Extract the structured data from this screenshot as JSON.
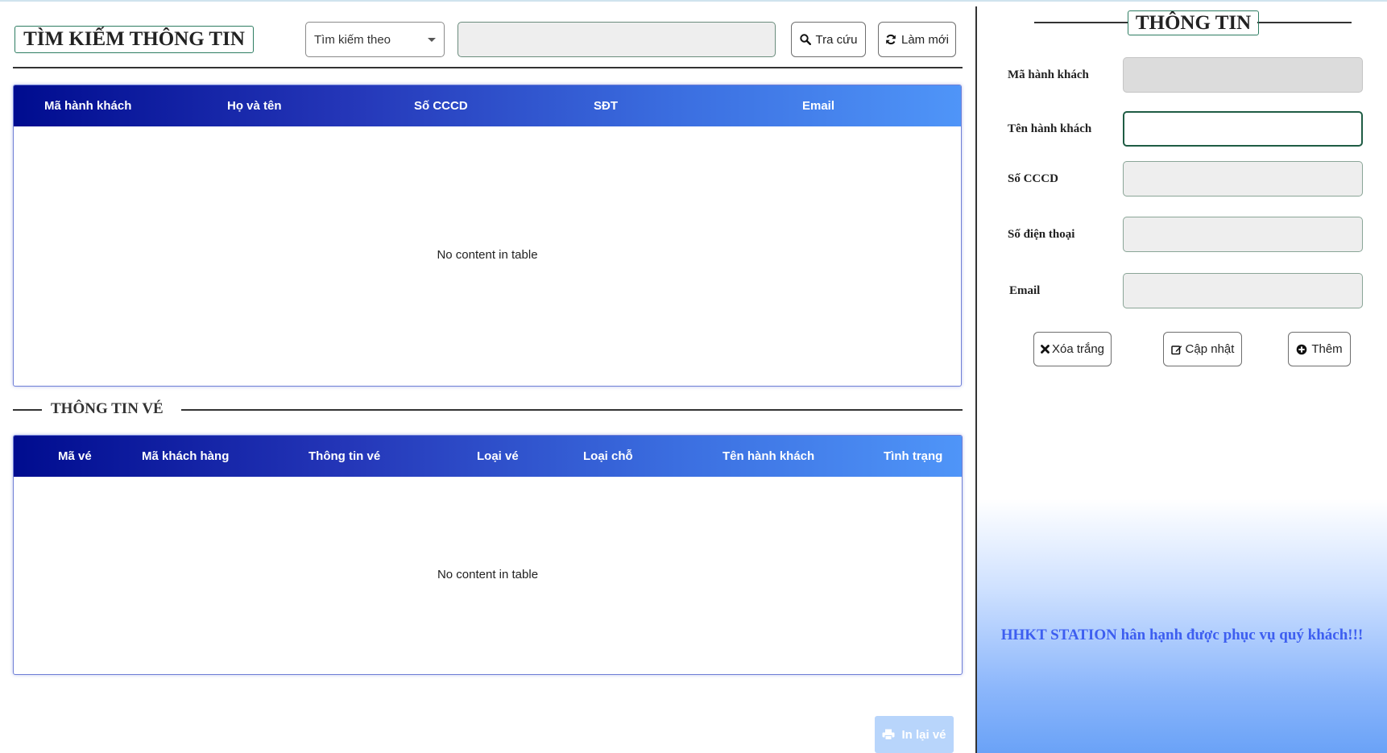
{
  "search": {
    "title": "TÌM KIẾM THÔNG TIN",
    "combo_label": "Tìm kiếm theo",
    "input_value": "",
    "lookup_label": "Tra cứu",
    "refresh_label": "Làm mới"
  },
  "passenger_table": {
    "columns": [
      "Mã hành khách",
      "Họ và tên",
      "Số CCCD",
      "SĐT",
      "Email"
    ],
    "empty_text": "No content in table"
  },
  "ticket_section": {
    "title": "THÔNG TIN VÉ"
  },
  "ticket_table": {
    "columns": [
      "Mã vé",
      "Mã khách hàng",
      "Thông tin vé",
      "Loại vé",
      "Loại chỗ",
      "Tên hành khách",
      "Tình trạng"
    ],
    "empty_text": "No content in table"
  },
  "print_button": {
    "label": "In lại vé"
  },
  "info_panel": {
    "title": "THÔNG TIN",
    "fields": [
      {
        "label": "Mã hành khách",
        "value": ""
      },
      {
        "label": "Tên hành khách",
        "value": ""
      },
      {
        "label": "Số CCCD",
        "value": ""
      },
      {
        "label": "Số điện thoại",
        "value": ""
      },
      {
        "label": "Email",
        "value": ""
      }
    ],
    "clear_label": "Xóa trắng",
    "update_label": "Cập nhật",
    "add_label": "Thêm",
    "slogan": "HHKT STATION hân hạnh được phục vụ quý khách!!!"
  },
  "colors": {
    "table_header_start": "#000c8f",
    "table_header_end": "#4f95f8",
    "slogan": "#3d5ef0",
    "title_border": "#2e7d62"
  }
}
